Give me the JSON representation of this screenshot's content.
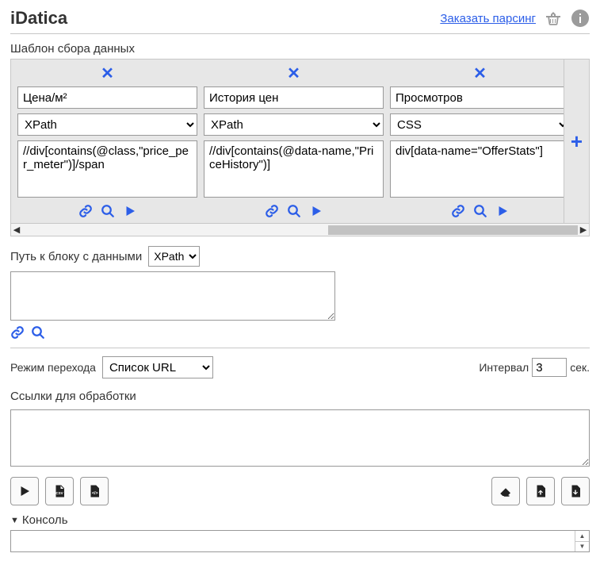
{
  "header": {
    "title": "iDatica",
    "order_link": "Заказать парсинг"
  },
  "template": {
    "section_label": "Шаблон сбора данных",
    "selector_options": [
      "XPath",
      "CSS"
    ],
    "columns": [
      {
        "name": "Цена/м²",
        "selector_type": "XPath",
        "expression": "//div[contains(@class,\"price_per_meter\")]/span"
      },
      {
        "name": "История цен",
        "selector_type": "XPath",
        "expression": "//div[contains(@data-name,\"PriceHistory\")]"
      },
      {
        "name": "Просмотров",
        "selector_type": "CSS",
        "expression": "div[data-name=\"OfferStats\"]"
      }
    ],
    "add_symbol": "+"
  },
  "block_path": {
    "label": "Путь к блоку с данными",
    "selector_type": "XPath",
    "value": ""
  },
  "mode": {
    "label": "Режим перехода",
    "value": "Список URL",
    "options": [
      "Список URL"
    ],
    "interval_label": "Интервал",
    "interval_value": "3",
    "interval_unit": "сек."
  },
  "links": {
    "label": "Ссылки для обработки",
    "value": ""
  },
  "console": {
    "label": "Консоль",
    "value": ""
  }
}
